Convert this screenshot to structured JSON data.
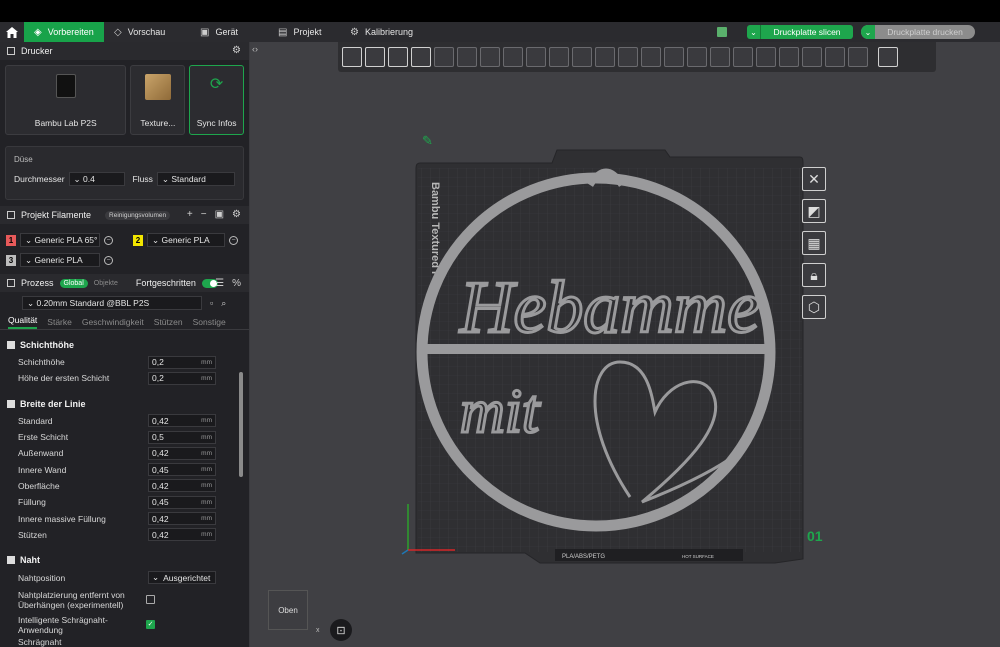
{
  "topbar": {
    "tabs": [
      {
        "label": "Vorbereiten",
        "icon": "cube-icon"
      },
      {
        "label": "Vorschau",
        "icon": "layers-icon"
      },
      {
        "label": "Gerät",
        "icon": "device-icon"
      },
      {
        "label": "Projekt",
        "icon": "project-icon"
      },
      {
        "label": "Kalibrierung",
        "icon": "calibration-icon"
      }
    ],
    "slice_label": "Druckplatte slicen",
    "print_label": "Druckplatte drucken"
  },
  "printer": {
    "section_title": "Drucker",
    "printer_name": "Bambu Lab P2S",
    "plate_name": "Texture...",
    "sync_label": "Sync Infos"
  },
  "nozzle": {
    "title": "Düse",
    "diameter_label": "Durchmesser",
    "diameter_value": "0.4",
    "flow_label": "Fluss",
    "flow_value": "Standard"
  },
  "filaments": {
    "section_title": "Projekt Filamente",
    "tag": "Reinigungsvolumen",
    "items": [
      {
        "num": "1",
        "name": "Generic PLA 65°",
        "color": "#e85a5a"
      },
      {
        "num": "2",
        "name": "Generic PLA",
        "color": "#f2e600"
      },
      {
        "num": "3",
        "name": "Generic PLA",
        "color": "#bdbdbd"
      }
    ]
  },
  "process": {
    "section_title": "Prozess",
    "global_label": "Global",
    "objects_label": "Objekte",
    "advanced_label": "Fortgeschritten",
    "preset": "0.20mm Standard @BBL P2S",
    "subtabs": [
      "Qualität",
      "Stärke",
      "Geschwindigkeit",
      "Stützen",
      "Sonstige"
    ],
    "groups": [
      {
        "title": "Schichthöhe",
        "rows": [
          {
            "name": "Schichthöhe",
            "value": "0,2",
            "unit": "mm"
          },
          {
            "name": "Höhe der ersten Schicht",
            "value": "0,2",
            "unit": "mm"
          }
        ]
      },
      {
        "title": "Breite der Linie",
        "rows": [
          {
            "name": "Standard",
            "value": "0,42",
            "unit": "mm"
          },
          {
            "name": "Erste Schicht",
            "value": "0,5",
            "unit": "mm"
          },
          {
            "name": "Außenwand",
            "value": "0,42",
            "unit": "mm"
          },
          {
            "name": "Innere Wand",
            "value": "0,45",
            "unit": "mm"
          },
          {
            "name": "Oberfläche",
            "value": "0,42",
            "unit": "mm"
          },
          {
            "name": "Füllung",
            "value": "0,45",
            "unit": "mm"
          },
          {
            "name": "Innere massive Füllung",
            "value": "0,42",
            "unit": "mm"
          },
          {
            "name": "Stützen",
            "value": "0,42",
            "unit": "mm"
          }
        ]
      },
      {
        "title": "Naht"
      }
    ],
    "seam": {
      "position_label": "Nahtposition",
      "position_value": "Ausgerichtet",
      "overhang_label": "Nahtplatzierung entfernt von Überhängen (experimentell)",
      "scarf_app_label": "Intelligente Schrägnaht-Anwendung",
      "scarf_label": "Schrägnaht"
    }
  },
  "viewport": {
    "plate_brand": "Bambu Textured P",
    "plate_text_1": "PLA/ABS/PETG",
    "plate_text_2": "HOT SURFACE",
    "model_text_1": "Hebamme",
    "model_text_2": "mit",
    "plate_number": "01",
    "view_label": "Oben",
    "axis_x": "x"
  }
}
